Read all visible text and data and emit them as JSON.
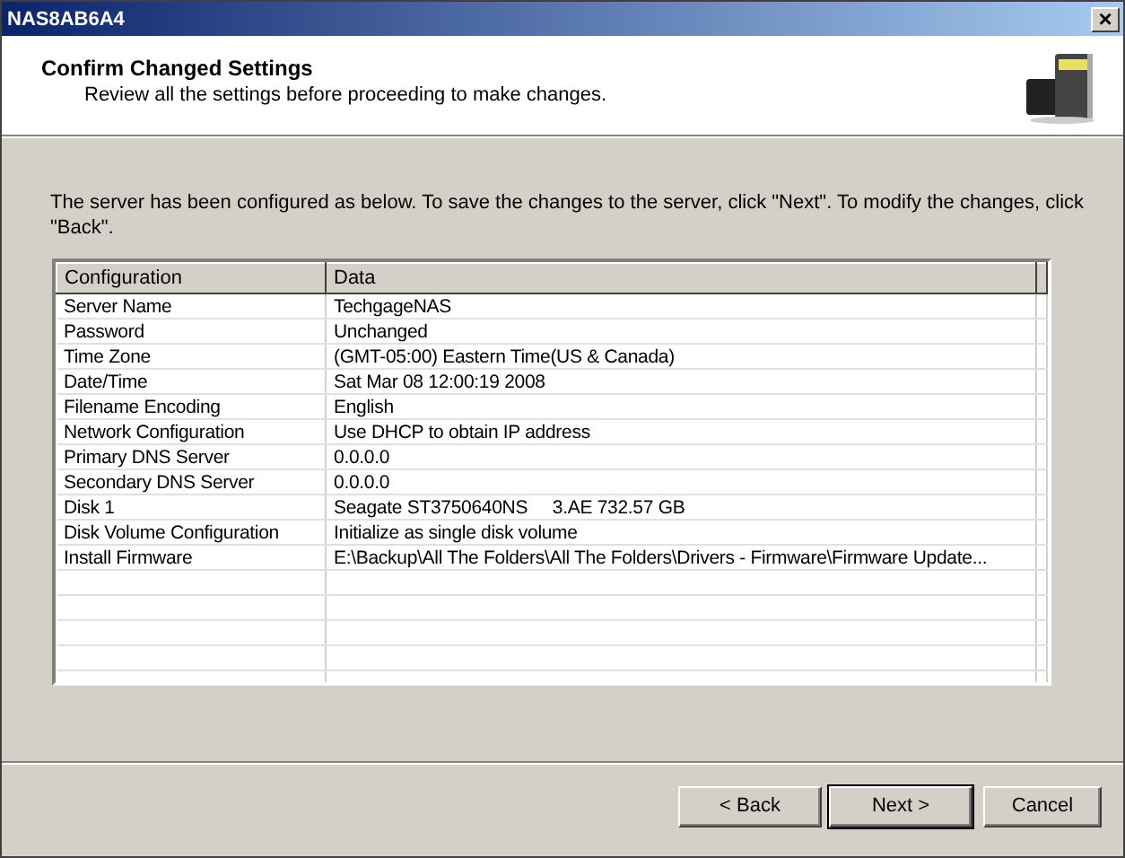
{
  "window": {
    "title": "NAS8AB6A4",
    "close": "×"
  },
  "header": {
    "title": "Confirm Changed Settings",
    "subtitle": "Review all the settings before proceeding to make changes."
  },
  "intro": "The server has been configured as below. To save the changes to the server, click \"Next\". To modify the changes, click \"Back\".",
  "table": {
    "columns": [
      "Configuration",
      "Data"
    ],
    "rows": [
      [
        "Server Name",
        "TechgageNAS"
      ],
      [
        "Password",
        "Unchanged"
      ],
      [
        "Time Zone",
        "(GMT-05:00) Eastern Time(US & Canada)"
      ],
      [
        "Date/Time",
        "Sat Mar 08 12:00:19 2008"
      ],
      [
        "Filename Encoding",
        "English"
      ],
      [
        "Network Configuration",
        "Use DHCP to obtain IP address"
      ],
      [
        "Primary DNS Server",
        "0.0.0.0"
      ],
      [
        "Secondary DNS Server",
        "0.0.0.0"
      ],
      [
        "Disk 1",
        "Seagate ST3750640NS     3.AE 732.57 GB"
      ],
      [
        "Disk Volume Configuration",
        "Initialize as single disk volume"
      ],
      [
        "Install Firmware",
        "E:\\Backup\\All The Folders\\All The Folders\\Drivers - Firmware\\Firmware Update..."
      ]
    ]
  },
  "buttons": [
    {
      "label": "< Back",
      "default": false
    },
    {
      "label": "Next >",
      "default": true
    },
    {
      "label": "Cancel",
      "default": false
    }
  ]
}
